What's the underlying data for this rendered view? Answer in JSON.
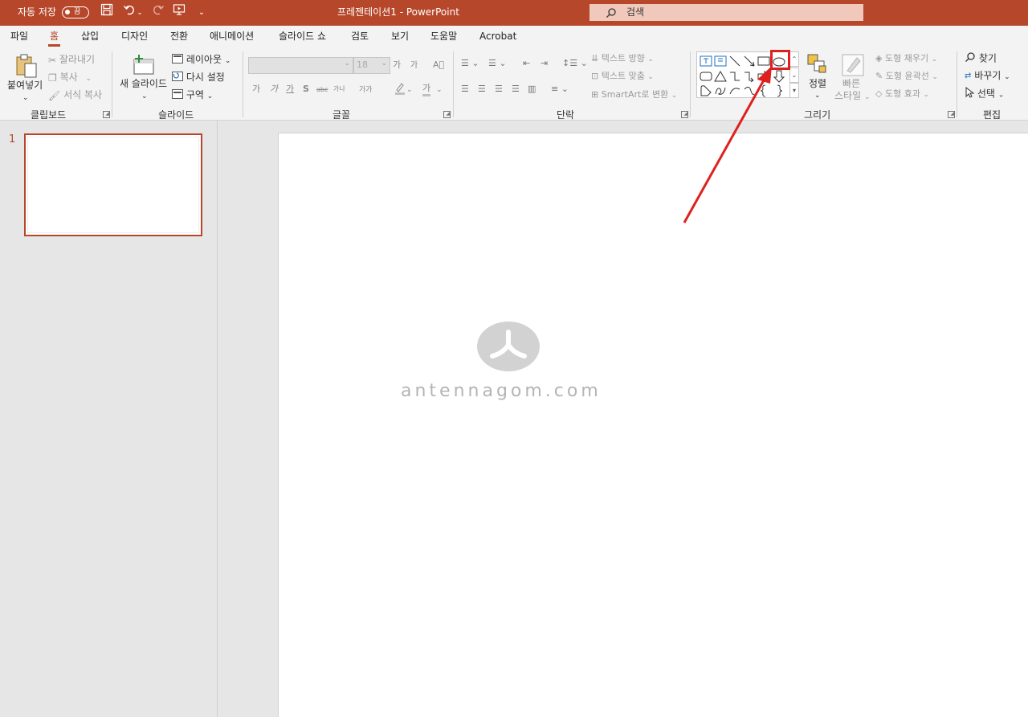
{
  "titlebar": {
    "autosave_label": "자동 저장",
    "autosave_state": "끔",
    "document_title": "프레젠테이션1  -  PowerPoint",
    "search_placeholder": "검색"
  },
  "tabs": [
    {
      "label": "파일"
    },
    {
      "label": "홈"
    },
    {
      "label": "삽입"
    },
    {
      "label": "디자인"
    },
    {
      "label": "전환"
    },
    {
      "label": "애니메이션"
    },
    {
      "label": "슬라이드 쇼"
    },
    {
      "label": "검토"
    },
    {
      "label": "보기"
    },
    {
      "label": "도움말"
    },
    {
      "label": "Acrobat"
    }
  ],
  "active_tab": "홈",
  "ribbon": {
    "clipboard": {
      "group_label": "클립보드",
      "paste": "붙여넣기",
      "cut": "잘라내기",
      "copy": "복사",
      "format_painter": "서식 복사"
    },
    "slides": {
      "group_label": "슬라이드",
      "new_slide": "새 슬라이드",
      "layout": "레이아웃",
      "reset": "다시 설정",
      "section": "구역"
    },
    "font": {
      "group_label": "글꼴",
      "font_size": "18",
      "bold": "가",
      "italic": "가",
      "underline": "가",
      "shadow": "S",
      "strikethrough": "abc",
      "char_spacing": "가나",
      "change_case": "가가",
      "font_color": "가",
      "grow": "가",
      "shrink": "가"
    },
    "paragraph": {
      "group_label": "단락",
      "text_direction": "텍스트 방향",
      "align_text": "텍스트 맞춤",
      "smartart": "SmartArt로 변환"
    },
    "drawing": {
      "group_label": "그리기",
      "arrange": "정렬",
      "quick_styles_1": "빠른",
      "quick_styles_2": "스타일",
      "shape_fill": "도형 채우기",
      "shape_outline": "도형 윤곽선",
      "shape_effects": "도형 효과"
    },
    "editing": {
      "group_label": "편집",
      "find": "찾기",
      "replace": "바꾸기",
      "select": "선택"
    }
  },
  "slides_pane": {
    "slide_number": "1"
  },
  "watermark": {
    "text": "antennagom.com"
  },
  "colors": {
    "accent": "#b7472a",
    "annotation_red": "#e0201e"
  }
}
